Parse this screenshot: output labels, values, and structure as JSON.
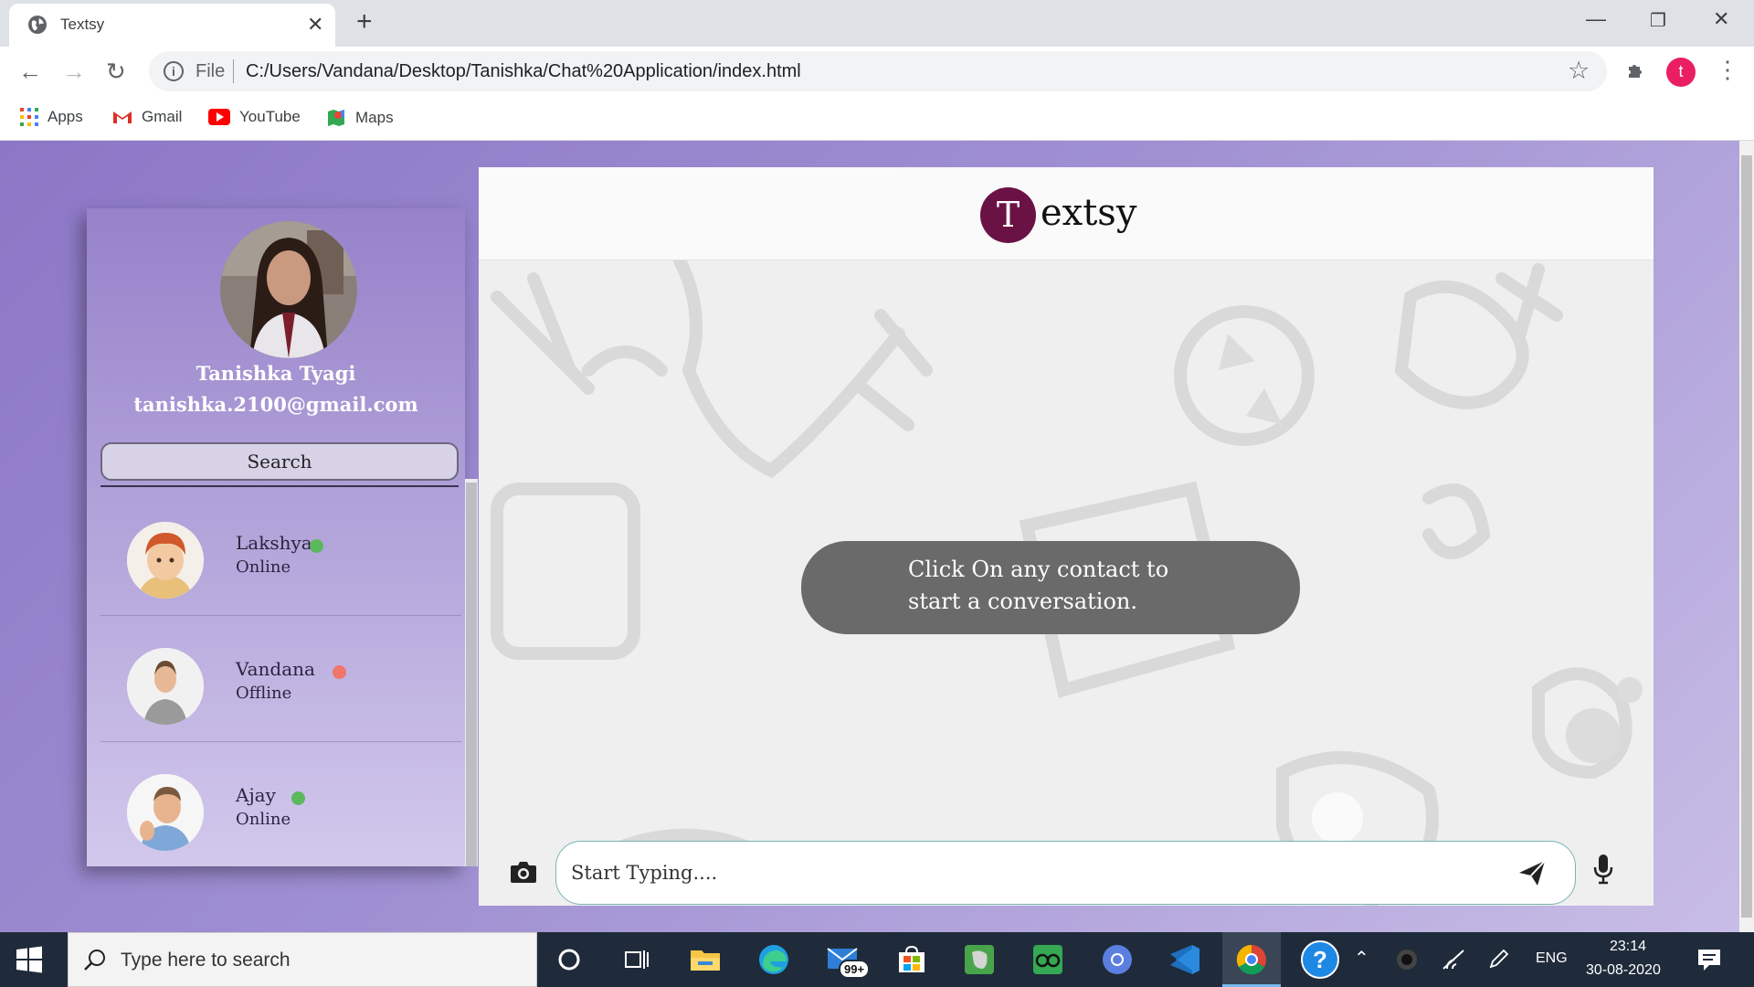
{
  "browser": {
    "tab_title": "Textsy",
    "url_scheme": "File",
    "url": "C:/Users/Vandana/Desktop/Tanishka/Chat%20Application/index.html",
    "profile_initial": "t",
    "bookmarks": [
      "Apps",
      "Gmail",
      "YouTube",
      "Maps"
    ]
  },
  "app": {
    "logo_letter": "T",
    "logo_rest": "extsy",
    "user": {
      "name": "Tanishka Tyagi",
      "email": "tanishka.2100@gmail.com"
    },
    "search_label": "Search",
    "contacts": [
      {
        "name": "Lakshya",
        "status": "Online",
        "status_color": "#5cb85c"
      },
      {
        "name": "Vandana",
        "status": "Offline",
        "status_color": "#f0756a"
      },
      {
        "name": "Ajay",
        "status": "Online",
        "status_color": "#5cb85c"
      }
    ],
    "prompt_line1": "Click On any contact to",
    "prompt_line2": "start a conversation.",
    "input_placeholder": "Start Typing...."
  },
  "taskbar": {
    "search_placeholder": "Type here to search",
    "mail_badge": "99+",
    "language": "ENG",
    "time": "23:14",
    "date": "30-08-2020"
  },
  "colors": {
    "page_gradient_start": "#8c77c6",
    "logo_circle": "#6b1245",
    "online": "#5cb85c",
    "offline": "#f0756a",
    "prompt_bubble": "#6a6a6a"
  }
}
